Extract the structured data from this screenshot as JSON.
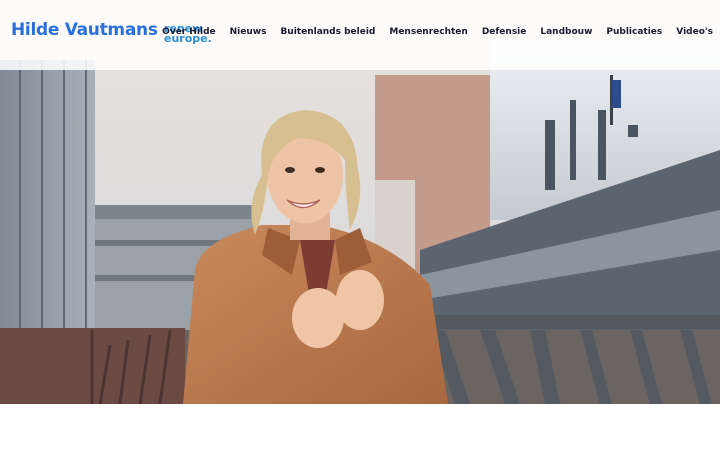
{
  "site": {
    "name": "Hilde Vautmans",
    "party_logo_line1": "renew",
    "party_logo_line2": "europe."
  },
  "nav": {
    "items": [
      {
        "label": "Over Hilde"
      },
      {
        "label": "Nieuws"
      },
      {
        "label": "Buitenlands beleid"
      },
      {
        "label": "Mensenrechten"
      },
      {
        "label": "Defensie"
      },
      {
        "label": "Landbouw"
      },
      {
        "label": "Publicaties"
      },
      {
        "label": "Video's"
      }
    ]
  },
  "colors": {
    "brand_blue": "#2a6fdb",
    "party_blue": "#2a8fd8",
    "nav_text": "#1a1a2e"
  }
}
